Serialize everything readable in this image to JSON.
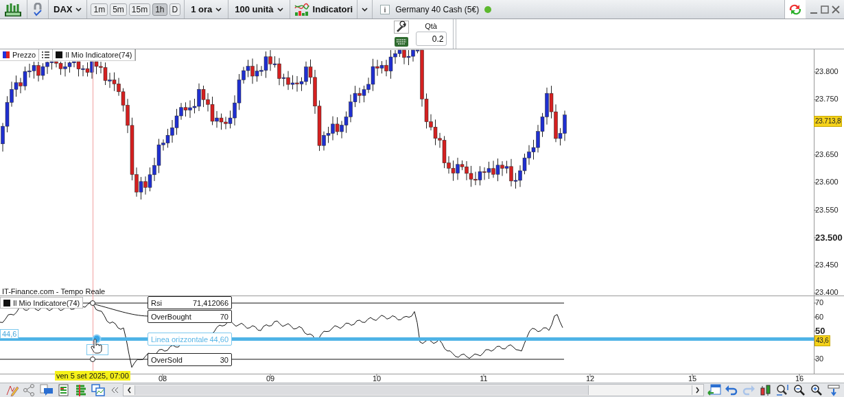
{
  "toolbar": {
    "symbol": "DAX",
    "timeframes": [
      {
        "label": "1m",
        "selected": false
      },
      {
        "label": "5m",
        "selected": false
      },
      {
        "label": "15m",
        "selected": false
      },
      {
        "label": "1h",
        "selected": true
      },
      {
        "label": "D",
        "selected": false
      }
    ],
    "period": "1 ora",
    "units": "100 unità",
    "indicators_button": "Indicatori",
    "instrument": "Germany 40 Cash (5€)",
    "market_open": true
  },
  "order_panel": {
    "quantity_label": "Qtà",
    "quantity": "0.2"
  },
  "price_chart": {
    "legend": [
      {
        "label": "Prezzo",
        "kind": "price"
      },
      {
        "label": "Il Mio Indicatore(74)",
        "kind": "indicator"
      }
    ],
    "y_axis": [
      {
        "label": "23.800",
        "major": false
      },
      {
        "label": "23.750",
        "major": false
      },
      {
        "label": "23.650",
        "major": false
      },
      {
        "label": "23.600",
        "major": false
      },
      {
        "label": "23.550",
        "major": false
      },
      {
        "label": "23.500",
        "major": true
      },
      {
        "label": "23.450",
        "major": false
      },
      {
        "label": "23.400",
        "major": false
      }
    ],
    "current_price": "23.713,8",
    "source": "IT-Finance.com - Tempo Reale"
  },
  "indicator_panel": {
    "title": "Il Mio Indicatore(74)",
    "y_axis": [
      {
        "label": "70",
        "major": false
      },
      {
        "label": "60",
        "major": false
      },
      {
        "label": "50",
        "major": true
      },
      {
        "label": "30",
        "major": false
      }
    ],
    "current_value": "43,6",
    "line_value": "44,6",
    "labels": [
      {
        "name": "Rsi",
        "value": "71,412066",
        "selected": false
      },
      {
        "name": "OverBought",
        "value": "70",
        "selected": false
      },
      {
        "name": "Linea orizzontale",
        "value": "44,60",
        "selected": true
      },
      {
        "name": "OverSold",
        "value": "30",
        "selected": false
      }
    ]
  },
  "time_axis": {
    "cursor_label": "ven 5 set 2025, 07:00",
    "ticks": [
      "08",
      "09",
      "10",
      "11",
      "12",
      "15",
      "16"
    ]
  }
}
